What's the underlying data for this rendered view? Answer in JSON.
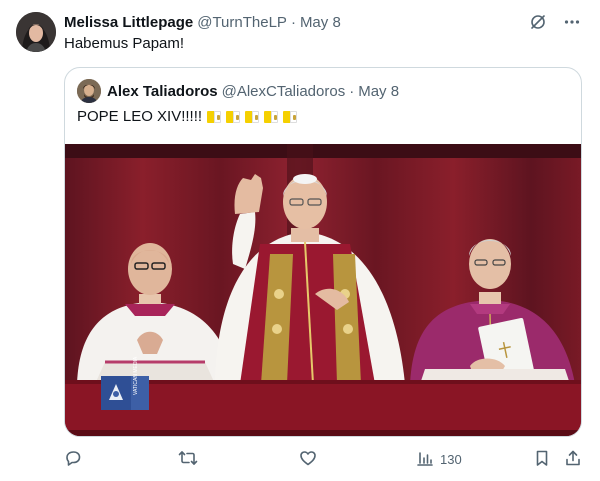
{
  "tweet": {
    "author_name": "Melissa Littlepage",
    "author_handle": "@TurnTheLP",
    "separator": "·",
    "date": "May 8",
    "text": "Habemus Papam!"
  },
  "quoted_tweet": {
    "author_name": "Alex Taliadoros",
    "author_handle": "@AlexCTaliadoros",
    "separator": "·",
    "date": "May 8",
    "text": "POPE LEO XIV!!!!!",
    "flag_emoji": "vatican-flag-icon",
    "flag_count": 5,
    "media_watermark": "VATICAN MEDIA"
  },
  "actions": {
    "views_count": "130"
  },
  "icons": [
    "grok-icon",
    "more-icon",
    "reply-icon",
    "retweet-icon",
    "like-icon",
    "views-icon",
    "bookmark-icon",
    "share-icon"
  ],
  "colors": {
    "text_primary": "#0f1419",
    "text_secondary": "#536471",
    "border": "#cfd9de",
    "curtain_red": "#8a1f2b"
  }
}
